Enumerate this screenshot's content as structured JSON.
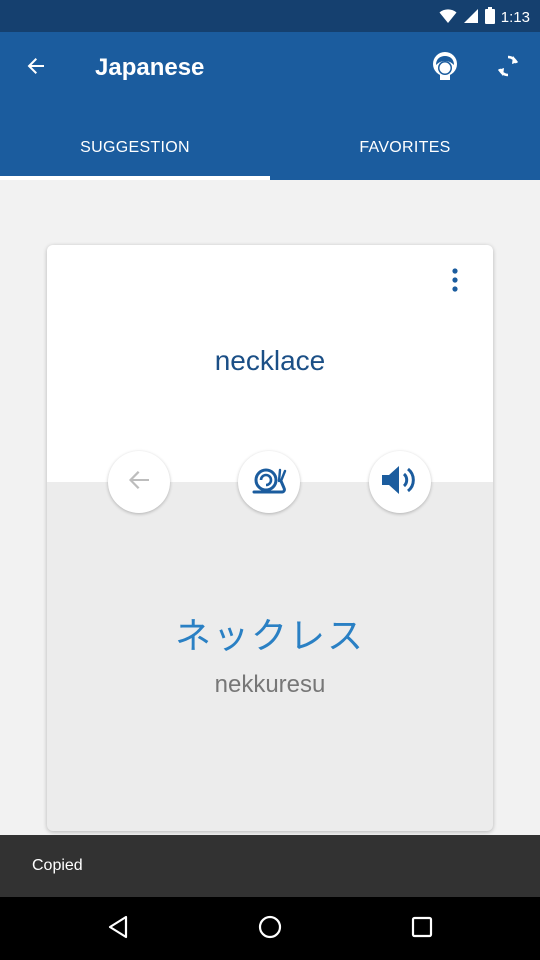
{
  "status_bar": {
    "time": "1:13",
    "icons": [
      "wifi-icon",
      "signal-icon",
      "battery-icon"
    ]
  },
  "app_bar": {
    "title": "Japanese",
    "icons": {
      "back": "arrow-back-icon",
      "profile": "profile-icon",
      "refresh": "refresh-icon"
    }
  },
  "tabs": [
    {
      "label": "SUGGESTION",
      "active": true
    },
    {
      "label": "FAVORITES",
      "active": false
    }
  ],
  "card": {
    "word": "necklace",
    "translation": "ネックレス",
    "romanization": "nekkuresu",
    "buttons": [
      "previous-arrow-icon",
      "snail-icon",
      "speaker-icon"
    ],
    "menu_icon": "more-vertical-icon"
  },
  "snackbar": {
    "message": "Copied"
  },
  "colors": {
    "status_bar": "#15406f",
    "app_bar": "#1b5c9e",
    "word_en": "#1b4f86",
    "word_jp": "#2a80c4",
    "snail_icon": "#1b5c9e",
    "speaker_icon": "#1b5c9e"
  }
}
